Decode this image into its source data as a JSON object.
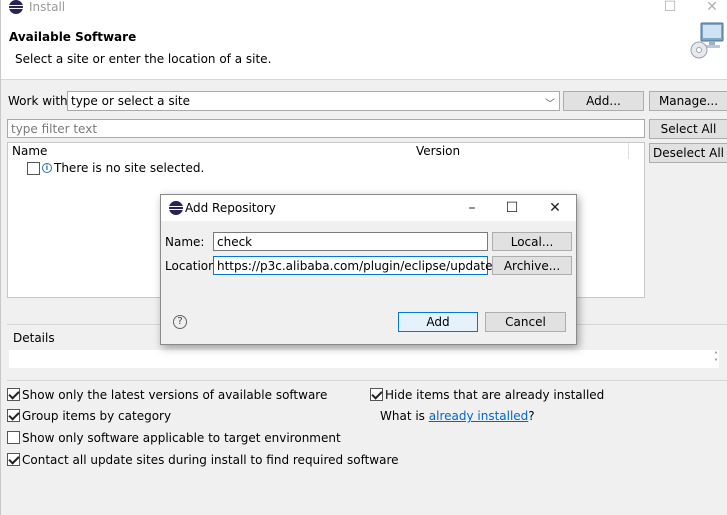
{
  "window": {
    "title": "Install",
    "header_title": "Available Software",
    "header_subtitle": "Select a site or enter the location of a site."
  },
  "controls": {
    "work_with_label": "Work with:",
    "work_with_placeholder": "type or select a site",
    "add_button": "Add...",
    "manage_button": "Manage...",
    "filter_placeholder": "type filter text",
    "select_all_button": "Select All",
    "deselect_all_button": "Deselect All"
  },
  "table": {
    "columns": [
      "Name",
      "Version"
    ],
    "rows": [
      {
        "label": "There is no site selected.",
        "checked": false
      }
    ]
  },
  "details": {
    "label": "Details"
  },
  "options": [
    {
      "label": "Show only the latest versions of available software",
      "checked": true
    },
    {
      "label": "Group items by category",
      "checked": true
    },
    {
      "label": "Show only software applicable to target environment",
      "checked": false
    },
    {
      "label": "Contact all update sites during install to find required software",
      "checked": true
    }
  ],
  "right_options": {
    "hide_installed_label": "Hide items that are already installed",
    "hide_installed_checked": true,
    "what_is_prefix": "What is ",
    "already_installed_link": "already installed",
    "what_is_suffix": "?"
  },
  "dialog": {
    "title": "Add Repository",
    "name_label": "Name:",
    "name_value": "check",
    "location_label": "Location:",
    "location_value": "https://p3c.alibaba.com/plugin/eclipse/update",
    "local_button": "Local...",
    "archive_button": "Archive...",
    "add_button": "Add",
    "cancel_button": "Cancel"
  },
  "colors": {
    "link": "#0066cc",
    "focus": "#0078d7"
  }
}
